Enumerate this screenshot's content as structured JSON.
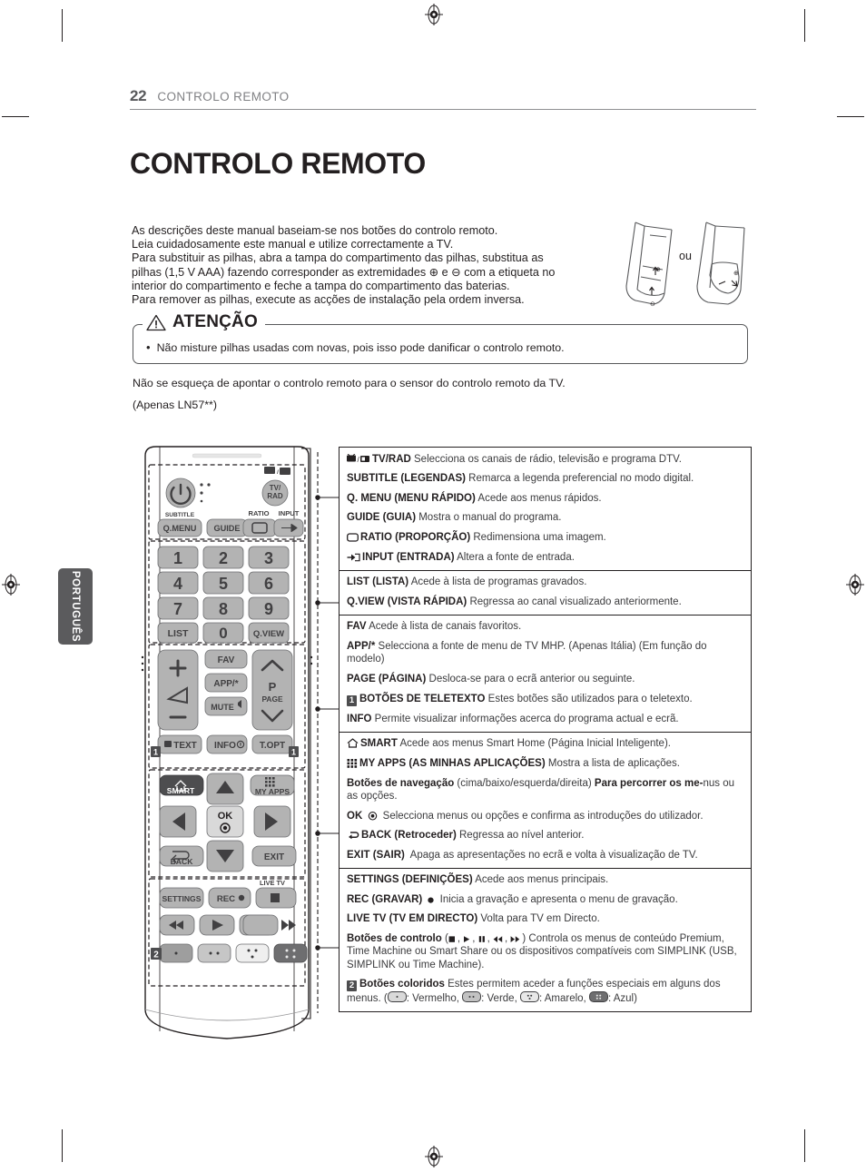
{
  "page": {
    "number": "22",
    "header_title": "CONTROLO REMOTO",
    "chapter_title": "CONTROLO REMOTO",
    "language_tab": "PORTUGUÊS"
  },
  "intro": {
    "line1": "As descrições deste manual baseiam-se nos botões do controlo remoto.",
    "line2": "Leia cuidadosamente este manual e utilize correctamente a TV.",
    "line3": "Para substituir as pilhas, abra a tampa do compartimento das pilhas, substitua as",
    "line4": "pilhas (1,5 V AAA) fazendo corresponder as extremidades ⊕ e ⊖ com a etiqueta no",
    "line5": "interior do compartimento e feche a tampa do compartimento das baterias.",
    "line6": "Para remover as pilhas, execute as acções de instalação pela ordem inversa."
  },
  "battery_illustration": {
    "or_label": "ou"
  },
  "caution": {
    "title": "ATENÇÃO",
    "bullet": "•",
    "text": "Não misture pilhas usadas com novas, pois isso pode danificar o controlo remoto."
  },
  "notes": {
    "note1": "Não se esqueça de apontar o controlo remoto para o sensor do controlo remoto da TV.",
    "note2": "(Apenas LN57**)"
  },
  "remote": {
    "buttons": {
      "power": "⏻",
      "tv_rad": "TV/RAD",
      "subtitle": "SUBTITLE",
      "q_menu": "Q.MENU",
      "guide": "GUIDE",
      "ratio": "RATIO",
      "input": "INPUT",
      "n1": "1",
      "n2": "2",
      "n3": "3",
      "n4": "4",
      "n5": "5",
      "n6": "6",
      "n7": "7",
      "n8": "8",
      "n9": "9",
      "list": "LIST",
      "n0": "0",
      "qview": "Q.VIEW",
      "fav": "FAV",
      "app": "APP/*",
      "mute": "MUTE",
      "p": "P",
      "page": "PAGE",
      "text": "TEXT",
      "info": "INFO",
      "t_opt": "T.OPT",
      "smart": "SMART",
      "my_apps": "MY APPS",
      "ok": "OK",
      "back": "BACK",
      "exit": "EXIT",
      "live_tv": "LIVE TV",
      "settings": "SETTINGS",
      "rec": "REC",
      "badge1": "1",
      "badge2": "2"
    }
  },
  "descriptions": {
    "sections": [
      {
        "rows": [
          {
            "icon": "tv-radio-icon",
            "bold": "TV/RAD",
            "text": " Selecciona os canais de rádio, televisão e programa DTV."
          },
          {
            "icon": null,
            "bold": "SUBTITLE (LEGENDAS)",
            "text": " Remarca a legenda preferencial no modo digital."
          },
          {
            "icon": null,
            "bold": "Q. MENU (MENU RÁPIDO)",
            "text": " Acede aos menus rápidos."
          },
          {
            "icon": null,
            "bold": "GUIDE (GUIA)",
            "text": " Mostra o manual do programa."
          },
          {
            "icon": "ratio-icon",
            "bold": "RATIO (PROPORÇÃO)",
            "text": " Redimensiona uma imagem."
          },
          {
            "icon": "input-icon",
            "bold": "INPUT (ENTRADA)",
            "text": " Altera a fonte de entrada."
          }
        ]
      },
      {
        "rows": [
          {
            "icon": null,
            "bold": "LIST (LISTA)",
            "text": " Acede à lista de programas gravados."
          },
          {
            "icon": null,
            "bold": "Q.VIEW (VISTA RÁPIDA)",
            "text": " Regressa ao canal visualizado anteriormente."
          }
        ]
      },
      {
        "rows": [
          {
            "icon": null,
            "bold": "FAV",
            "text": " Acede à lista de canais favoritos."
          },
          {
            "icon": null,
            "bold": "APP/*",
            "text": " Selecciona a fonte de menu de TV MHP. (Apenas Itália) (Em função do modelo)"
          },
          {
            "icon": null,
            "bold": "PAGE (PÁGINA)",
            "text": " Desloca-se para o ecrã anterior ou seguinte."
          },
          {
            "icon": "badge-1",
            "bold": "BOTÕES DE TELETEXTO",
            "text": " Estes botões são utilizados para o teletexto."
          },
          {
            "icon": null,
            "bold": "INFO",
            "text": " Permite visualizar informações acerca do programa actual e ecrã."
          }
        ]
      },
      {
        "rows": [
          {
            "icon": "home-icon",
            "bold": "SMART",
            "text": " Acede aos menus Smart Home (Página Inicial Inteligente)."
          },
          {
            "icon": "grid-icon",
            "bold": "MY APPS (AS MINHAS APLICAÇÕES)",
            "text": " Mostra a lista de aplicações."
          },
          {
            "icon": null,
            "bold": "Botões de navegação",
            "text": " (cima/baixo/esquerda/direita) ",
            "bold2": "Para percorrer os me-",
            "text2": "nus ou as opções."
          },
          {
            "icon": null,
            "bold": "OK",
            "text": " Selecciona menus ou opções e confirma as introduções do utilizador.",
            "mid_icon": "ok-dot-icon"
          },
          {
            "icon": "back-arrow-icon",
            "bold": "BACK (Retroceder)",
            "text": " Regressa ao nível anterior."
          },
          {
            "icon": null,
            "bold": "EXIT (SAIR)",
            "text": "  Apaga as apresentações no ecrã e volta à visualização de TV."
          }
        ]
      },
      {
        "rows": [
          {
            "icon": null,
            "bold": "SETTINGS (DEFINIÇÕES)",
            "text": " Acede aos menus principais."
          },
          {
            "icon": null,
            "bold": "REC (GRAVAR)",
            "text": " Inicia a gravação e apresenta o menu de gravação.",
            "mid_icon": "record-dot-icon"
          },
          {
            "icon": null,
            "bold": "LIVE TV (TV EM DIRECTO)",
            "text": " Volta para TV em Directo."
          },
          {
            "icon": null,
            "bold": "Botões de controlo",
            "text": " (■, ▶, ❙❙, ◀◀, ▶▶) Controla os menus de conteúdo Premium, Time Machine ou Smart Share ou os dispositivos compatíveis com SIMPLINK (USB, SIMPLINK ou Time Machine)."
          },
          {
            "icon": "badge-2",
            "bold": "Botões coloridos",
            "text": " Estes permitem aceder a funções especiais em alguns dos menus. (",
            "color_legend": [
              {
                "swatch": "red",
                "label": ": Vermelho, "
              },
              {
                "swatch": "green",
                "label": ": Verde, "
              },
              {
                "swatch": "yellow",
                "label": ": Amarelo, "
              },
              {
                "swatch": "blue",
                "label": ": Azul)"
              }
            ]
          }
        ]
      }
    ]
  },
  "colors": {
    "ink": "#231f20",
    "grey_text": "#808184",
    "tab_bg": "#5b5b5d",
    "button_fill": "#b3b3b3",
    "dark_button": "#4d4d4f"
  }
}
